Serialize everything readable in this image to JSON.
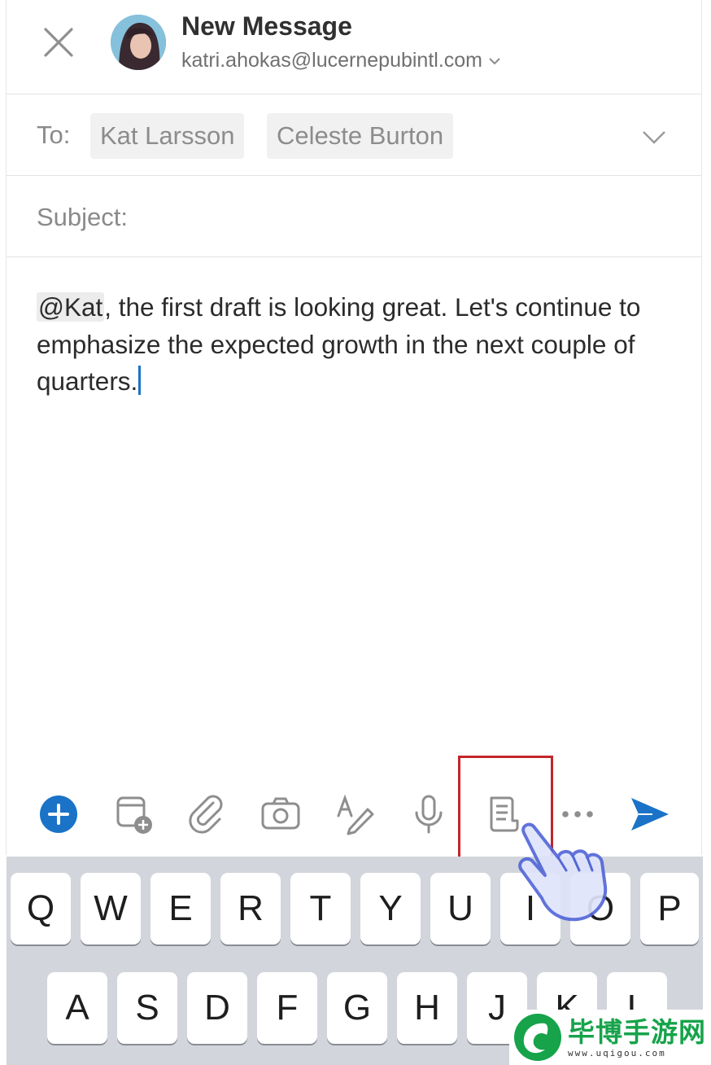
{
  "header": {
    "title": "New Message",
    "account": "katri.ahokas@lucernepubintl.com"
  },
  "to": {
    "label": "To:",
    "recipients": [
      "Kat Larsson",
      "Celeste Burton"
    ]
  },
  "subject": {
    "label": "Subject:",
    "value": ""
  },
  "body": {
    "mention": "@Kat",
    "text": ", the first draft is looking great. Let's continue to emphasize the expected growth in the next couple of quarters."
  },
  "toolbar": {
    "items": [
      "add-icon",
      "calendar-add-icon",
      "paperclip-icon",
      "camera-icon",
      "draw-icon",
      "microphone-icon",
      "template-icon",
      "more-icon",
      "send-icon"
    ],
    "accent_color": "#1a73c7",
    "highlight_color": "#c3252a"
  },
  "keyboard": {
    "row1": [
      "Q",
      "W",
      "E",
      "R",
      "T",
      "Y",
      "U",
      "I",
      "O",
      "P"
    ],
    "row2": [
      "A",
      "S",
      "D",
      "F",
      "G",
      "H",
      "J",
      "K",
      "L"
    ]
  },
  "watermark": {
    "text": "毕博手游网",
    "url": "www.uqigou.com"
  }
}
